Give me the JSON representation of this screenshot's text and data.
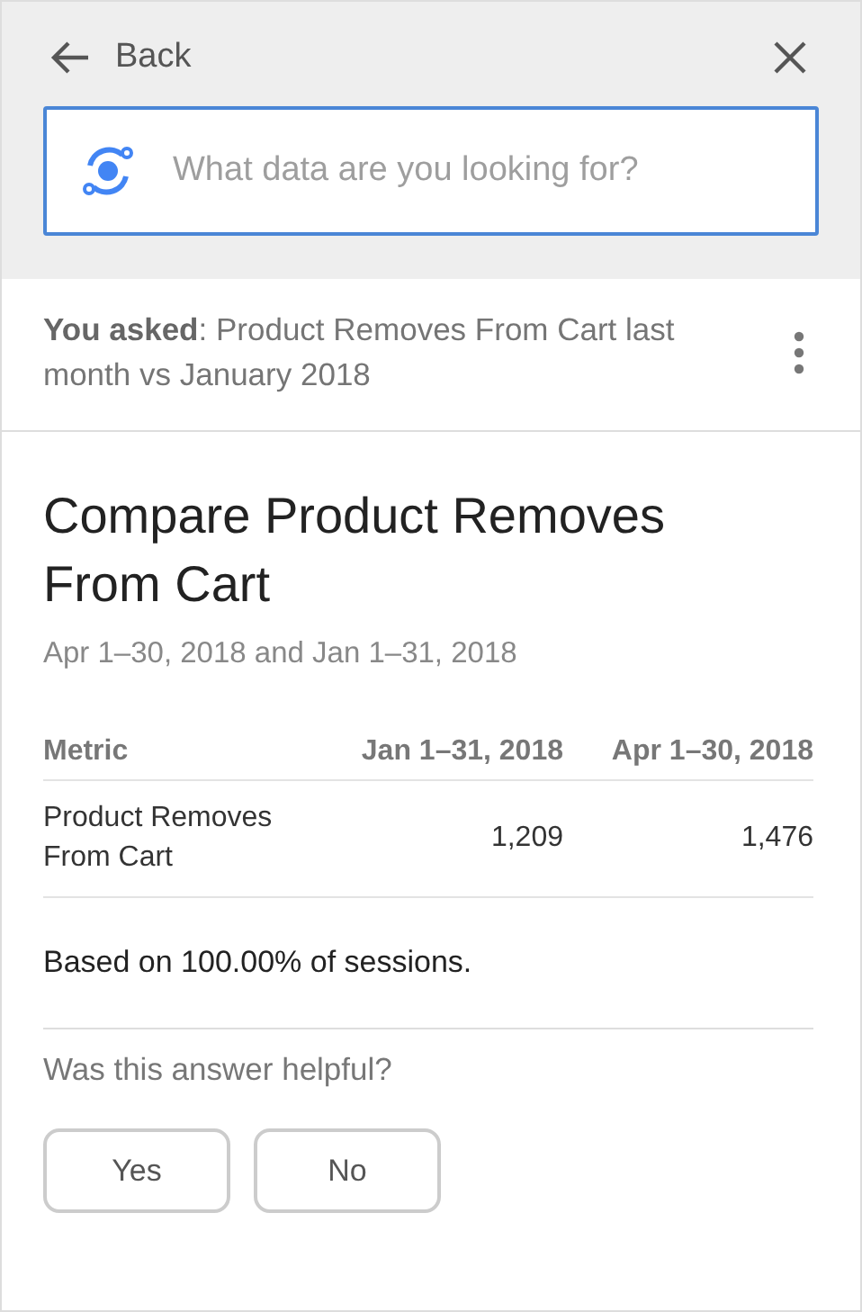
{
  "header": {
    "back_label": "Back",
    "search": {
      "placeholder": "What data are you looking for?"
    }
  },
  "question": {
    "text": "**You asked**:  Product Removes From Cart last month vs January 2018"
  },
  "answer": {
    "title": "Compare Product Removes From Cart",
    "subtitle": "Apr 1–30, 2018 and Jan 1–31, 2018",
    "table": {
      "columns": [
        "Metric",
        "Jan 1–31, 2018",
        "Apr 1–30, 2018"
      ],
      "rows": [
        [
          "Product Removes From Cart",
          "1,209",
          "1,476"
        ]
      ]
    },
    "note": "Based on 100.00% of sessions."
  },
  "feedback": {
    "prompt": "Was this answer helpful?",
    "buttons": [
      "Yes",
      "No"
    ]
  }
}
